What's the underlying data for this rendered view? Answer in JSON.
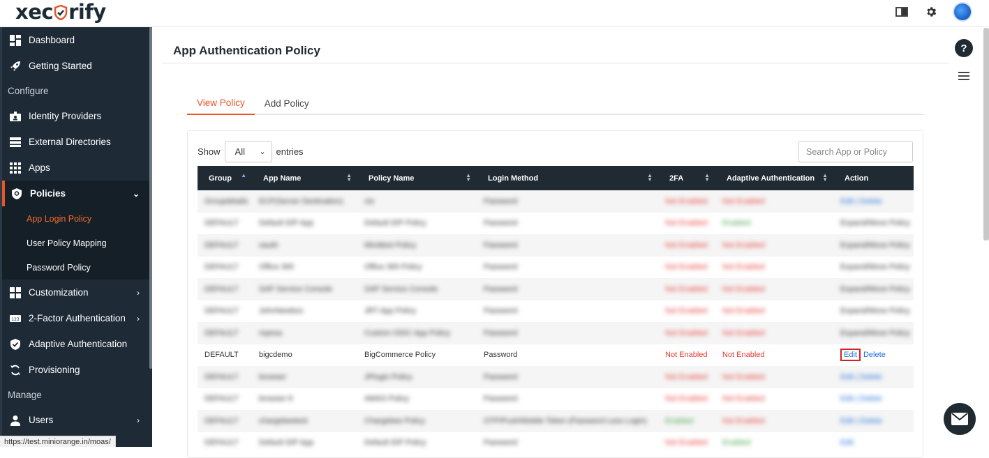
{
  "app": {
    "logo_prefix": "xec",
    "logo_suffix": "rify"
  },
  "sidebar": {
    "items": [
      {
        "label": "Dashboard",
        "icon": "dashboard-icon"
      },
      {
        "label": "Getting Started",
        "icon": "rocket-icon"
      }
    ],
    "configure_label": "Configure",
    "configure_items": [
      {
        "label": "Identity Providers",
        "icon": "id-card-icon"
      },
      {
        "label": "External Directories",
        "icon": "directory-icon"
      },
      {
        "label": "Apps",
        "icon": "grid-icon"
      }
    ],
    "policies": {
      "label": "Policies",
      "icon": "shield-icon",
      "subitems": [
        "App Login Policy",
        "User Policy Mapping",
        "Password Policy"
      ]
    },
    "more_items": [
      {
        "label": "Customization",
        "icon": "puzzle-icon"
      },
      {
        "label": "2-Factor Authentication",
        "icon": "2fa-icon"
      },
      {
        "label": "Adaptive Authentication",
        "icon": "shield-check-icon"
      },
      {
        "label": "Provisioning",
        "icon": "sync-icon"
      }
    ],
    "manage_label": "Manage",
    "manage_items": [
      {
        "label": "Users",
        "icon": "user-icon"
      }
    ]
  },
  "page": {
    "title": "App Authentication Policy",
    "tabs": [
      "View Policy",
      "Add Policy"
    ],
    "show_label": "Show",
    "entries_label": "entries",
    "entries_value": "All",
    "search_placeholder": "Search App or Policy"
  },
  "table": {
    "columns": [
      "Group",
      "App Name",
      "Policy Name",
      "Login Method",
      "2FA",
      "Adaptive Authentication",
      "Action"
    ],
    "rows": [
      {
        "group": "Groupdetails",
        "app": "ECP(Server Destination)",
        "policy": "cts",
        "login": "Password",
        "twofa": "Not Enabled",
        "adaptive": "Not Enabled",
        "action": "Edit | Delete",
        "blurred": true,
        "twofa_color": "red",
        "adaptive_color": "red",
        "action_color": "link"
      },
      {
        "group": "DEFAULT",
        "app": "Default IDP App",
        "policy": "Default IDP Policy",
        "login": "Password",
        "twofa": "Not Enabled",
        "adaptive": "Enabled",
        "action": "Expand/Move Policy",
        "blurred": true,
        "twofa_color": "red",
        "adaptive_color": "green",
        "action_color": "plain"
      },
      {
        "group": "DEFAULT",
        "app": "oauth",
        "policy": "Mindtest Policy",
        "login": "Password",
        "twofa": "Not Enabled",
        "adaptive": "Not Enabled",
        "action": "Expand/Move Policy",
        "blurred": true,
        "twofa_color": "red",
        "adaptive_color": "red",
        "action_color": "plain"
      },
      {
        "group": "DEFAULT",
        "app": "Office 365",
        "policy": "Office 365 Policy",
        "login": "Password",
        "twofa": "Not Enabled",
        "adaptive": "Not Enabled",
        "action": "Expand/Move Policy",
        "blurred": true,
        "twofa_color": "red",
        "adaptive_color": "red",
        "action_color": "plain"
      },
      {
        "group": "DEFAULT",
        "app": "SAP Service Console",
        "policy": "SAP Service Console",
        "login": "Password",
        "twofa": "Not Enabled",
        "adaptive": "Not Enabled",
        "action": "Expand/Move Policy",
        "blurred": true,
        "twofa_color": "red",
        "adaptive_color": "red",
        "action_color": "plain"
      },
      {
        "group": "DEFAULT",
        "app": "JohnNewbox",
        "policy": "JRT App Policy",
        "login": "Password",
        "twofa": "Not Enabled",
        "adaptive": "Not Enabled",
        "action": "Expand/Move Policy",
        "blurred": true,
        "twofa_color": "red",
        "adaptive_color": "red",
        "action_color": "plain"
      },
      {
        "group": "DEFAULT",
        "app": "mpesa",
        "policy": "Custom OIDC App Policy",
        "login": "Password",
        "twofa": "Not Enabled",
        "adaptive": "Not Enabled",
        "action": "Expand/Move Policy",
        "blurred": true,
        "twofa_color": "red",
        "adaptive_color": "red",
        "action_color": "plain"
      },
      {
        "group": "DEFAULT",
        "app": "bigcdemo",
        "policy": "BigCommerce Policy",
        "login": "Password",
        "twofa": "Not Enabled",
        "adaptive": "Not Enabled",
        "action_edit": "Edit",
        "action_delete": "Delete",
        "blurred": false,
        "twofa_color": "red",
        "adaptive_color": "red",
        "action_color": "link"
      },
      {
        "group": "DEFAULT",
        "app": "browser",
        "policy": "JPlugin Policy",
        "login": "Password",
        "twofa": "Not Enabled",
        "adaptive": "Not Enabled",
        "action": "Edit | Delete",
        "blurred": true,
        "twofa_color": "red",
        "adaptive_color": "red",
        "action_color": "link"
      },
      {
        "group": "DEFAULT",
        "app": "browser 8",
        "policy": "AWAS Policy",
        "login": "Password",
        "twofa": "Not Enabled",
        "adaptive": "Not Enabled",
        "action": "Edit | Delete",
        "blurred": true,
        "twofa_color": "red",
        "adaptive_color": "red",
        "action_color": "link"
      },
      {
        "group": "DEFAULT",
        "app": "chargebeetest",
        "policy": "Chargebee Policy",
        "login": "OTP/Push/Mobile Token (Password Less Login)",
        "twofa": "Enabled",
        "adaptive": "Not Enabled",
        "action": "Edit | Delete",
        "blurred": true,
        "twofa_color": "green",
        "adaptive_color": "red",
        "action_color": "link"
      },
      {
        "group": "DEFAULT",
        "app": "Default IDP App",
        "policy": "Default IDP Policy",
        "login": "Password",
        "twofa": "Not Enabled",
        "adaptive": "Enabled",
        "action": "Edit",
        "blurred": true,
        "twofa_color": "red",
        "adaptive_color": "green",
        "action_color": "link"
      }
    ]
  },
  "status_url": "https://test.miniorange.in/moas/",
  "colors": {
    "accent": "#e8562a",
    "sidebar_bg": "#1e2b37",
    "header_bg": "#1f2a33",
    "danger": "#e53935",
    "success": "#43a047",
    "link": "#1e6fd9"
  }
}
